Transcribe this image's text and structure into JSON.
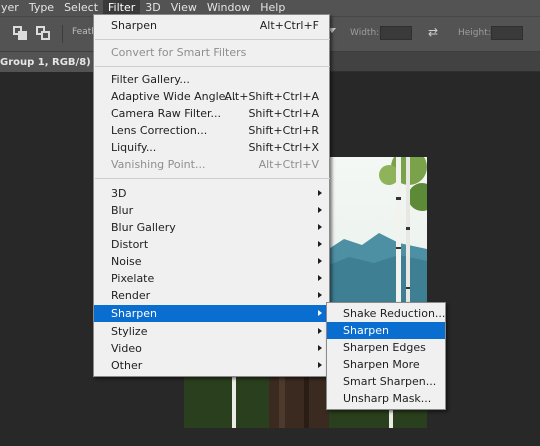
{
  "menubar": {
    "items": [
      {
        "label": "yer",
        "active": false
      },
      {
        "label": "Type",
        "active": false
      },
      {
        "label": "Select",
        "active": false
      },
      {
        "label": "Filter",
        "active": true
      },
      {
        "label": "3D",
        "active": false
      },
      {
        "label": "View",
        "active": false
      },
      {
        "label": "Window",
        "active": false
      },
      {
        "label": "Help",
        "active": false
      }
    ]
  },
  "options_bar": {
    "feather_label": "Feath",
    "width_label": "Width:",
    "height_label": "Height:",
    "swap_glyph": "⇄"
  },
  "document_tab": {
    "title": "Group 1, RGB/8)",
    "close_glyph": "×"
  },
  "filter_menu": {
    "items": [
      {
        "label": "Sharpen",
        "shortcut": "Alt+Ctrl+F",
        "disabled": false,
        "submenu": false,
        "highlighted": false
      },
      {
        "separator": true
      },
      {
        "label": "Convert for Smart Filters",
        "shortcut": "",
        "disabled": true,
        "submenu": false,
        "highlighted": false
      },
      {
        "separator": true
      },
      {
        "label": "Filter Gallery...",
        "shortcut": "",
        "disabled": false,
        "submenu": false,
        "highlighted": false
      },
      {
        "label": "Adaptive Wide Angle...",
        "shortcut": "Alt+Shift+Ctrl+A",
        "disabled": false,
        "submenu": false,
        "highlighted": false
      },
      {
        "label": "Camera Raw Filter...",
        "shortcut": "Shift+Ctrl+A",
        "disabled": false,
        "submenu": false,
        "highlighted": false
      },
      {
        "label": "Lens Correction...",
        "shortcut": "Shift+Ctrl+R",
        "disabled": false,
        "submenu": false,
        "highlighted": false
      },
      {
        "label": "Liquify...",
        "shortcut": "Shift+Ctrl+X",
        "disabled": false,
        "submenu": false,
        "highlighted": false
      },
      {
        "label": "Vanishing Point...",
        "shortcut": "Alt+Ctrl+V",
        "disabled": true,
        "submenu": false,
        "highlighted": false
      },
      {
        "separator": true
      },
      {
        "label": "3D",
        "shortcut": "",
        "disabled": false,
        "submenu": true,
        "highlighted": false
      },
      {
        "label": "Blur",
        "shortcut": "",
        "disabled": false,
        "submenu": true,
        "highlighted": false
      },
      {
        "label": "Blur Gallery",
        "shortcut": "",
        "disabled": false,
        "submenu": true,
        "highlighted": false
      },
      {
        "label": "Distort",
        "shortcut": "",
        "disabled": false,
        "submenu": true,
        "highlighted": false
      },
      {
        "label": "Noise",
        "shortcut": "",
        "disabled": false,
        "submenu": true,
        "highlighted": false
      },
      {
        "label": "Pixelate",
        "shortcut": "",
        "disabled": false,
        "submenu": true,
        "highlighted": false
      },
      {
        "label": "Render",
        "shortcut": "",
        "disabled": false,
        "submenu": true,
        "highlighted": false
      },
      {
        "label": "Sharpen",
        "shortcut": "",
        "disabled": false,
        "submenu": true,
        "highlighted": true
      },
      {
        "label": "Stylize",
        "shortcut": "",
        "disabled": false,
        "submenu": true,
        "highlighted": false
      },
      {
        "label": "Video",
        "shortcut": "",
        "disabled": false,
        "submenu": true,
        "highlighted": false
      },
      {
        "label": "Other",
        "shortcut": "",
        "disabled": false,
        "submenu": true,
        "highlighted": false
      }
    ]
  },
  "sharpen_submenu": {
    "items": [
      {
        "label": "Shake Reduction...",
        "highlighted": false
      },
      {
        "label": "Sharpen",
        "highlighted": true
      },
      {
        "label": "Sharpen Edges",
        "highlighted": false
      },
      {
        "label": "Sharpen More",
        "highlighted": false
      },
      {
        "label": "Smart Sharpen...",
        "highlighted": false
      },
      {
        "label": "Unsharp Mask...",
        "highlighted": false
      }
    ]
  },
  "colors": {
    "highlight": "#0a6ed1",
    "menu_bg": "#f0f0f0",
    "chrome": "#535353",
    "workspace": "#282828"
  }
}
